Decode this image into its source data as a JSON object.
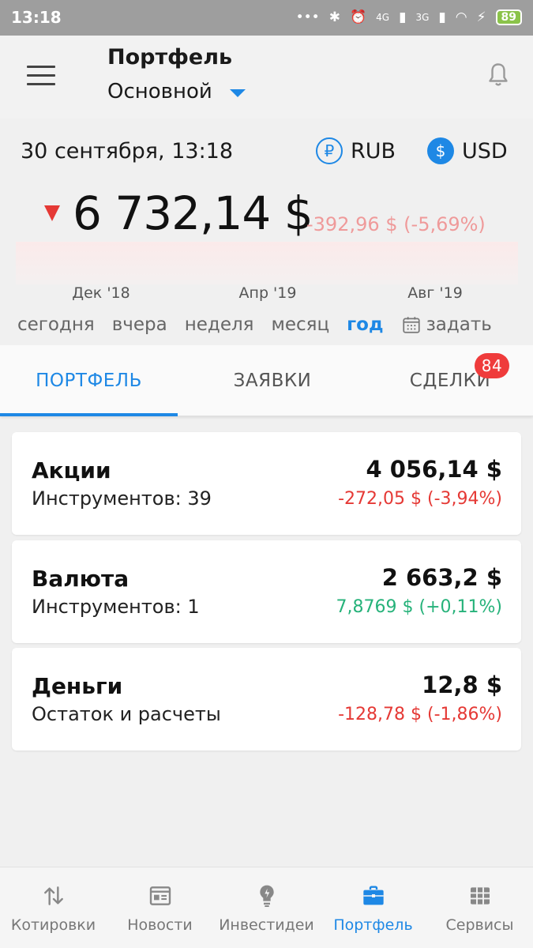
{
  "status": {
    "time": "13:18",
    "net1": "4G",
    "net2": "3G",
    "battery": "89"
  },
  "appbar": {
    "title": "Портфель",
    "subtitle": "Основной"
  },
  "summary": {
    "datetime": "30 сентября, 13:18",
    "currencies": [
      {
        "code": "RUB",
        "symbol": "₽"
      },
      {
        "code": "USD",
        "symbol": "$"
      }
    ],
    "total": "6 732,14 $",
    "change": "-392,96 $ (-5,69%)",
    "chart_xlabels": [
      "Дек '18",
      "Апр '19",
      "Авг '19"
    ],
    "periods": [
      "сегодня",
      "вчера",
      "неделя",
      "месяц",
      "год"
    ],
    "active_period": "год",
    "custom_period": "задать"
  },
  "tabs": [
    {
      "label": "ПОРТФЕЛЬ"
    },
    {
      "label": "ЗАЯВКИ"
    },
    {
      "label": "СДЕЛКИ",
      "badge": "84"
    }
  ],
  "cards": [
    {
      "name": "Акции",
      "sub": "Инструментов: 39",
      "value": "4 056,14 $",
      "delta": "-272,05 $ (-3,94%)",
      "trend": "neg"
    },
    {
      "name": "Валюта",
      "sub": "Инструментов: 1",
      "value": "2 663,2 $",
      "delta": "7,8769 $ (+0,11%)",
      "trend": "pos"
    },
    {
      "name": "Деньги",
      "sub": "Остаток и расчеты",
      "value": "12,8 $",
      "delta": "-128,78 $ (-1,86%)",
      "trend": "neg"
    }
  ],
  "bottomnav": [
    {
      "label": "Котировки",
      "icon": "arrows-updown-icon"
    },
    {
      "label": "Новости",
      "icon": "news-icon"
    },
    {
      "label": "Инвестидеи",
      "icon": "lightbulb-icon"
    },
    {
      "label": "Портфель",
      "icon": "briefcase-icon",
      "active": true
    },
    {
      "label": "Сервисы",
      "icon": "grid-icon"
    }
  ],
  "colors": {
    "accent": "#1e88e5",
    "negative": "#e53935",
    "positive": "#26b27a",
    "badge": "#ef3b3b"
  }
}
